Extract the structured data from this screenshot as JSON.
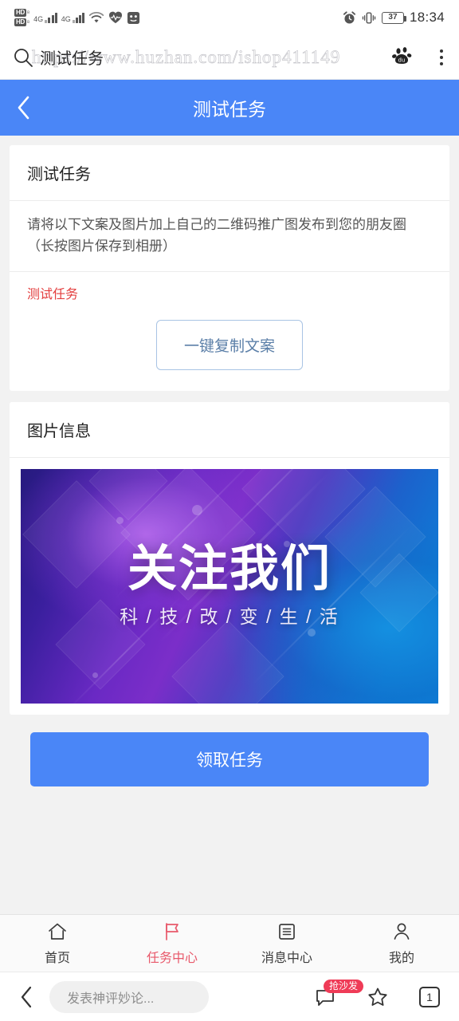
{
  "statusbar": {
    "hd_badge_1": "HD",
    "hd_badge_2": "HD",
    "hd_sub_1": "в",
    "hd_sub_2": "в",
    "net_1": "4G",
    "net_2": "4G",
    "battery": "37",
    "time": "18:34",
    "icons": [
      "hd-badge-icon",
      "signal-4g-icon",
      "wifi-icon",
      "heart-rate-icon",
      "app-icon",
      "alarm-clock-icon",
      "vibrate-icon",
      "battery-icon"
    ]
  },
  "browser": {
    "title": "测试任务",
    "watermark": "https://www.huzhan.com/ishop411149",
    "search_icon": "search-icon",
    "logo_icon": "baidu-logo-icon",
    "menu_icon": "more-vertical-icon"
  },
  "page_header": {
    "title": "测试任务",
    "back_icon": "chevron-left-icon"
  },
  "task_card": {
    "title": "测试任务",
    "description": "请将以下文案及图片加上自己的二维码推广图发布到您的朋友圈（长按图片保存到相册）",
    "copy_text": "测试任务",
    "copy_button": "一键复制文案"
  },
  "image_card": {
    "title": "图片信息",
    "banner": {
      "main_text": "关注我们",
      "sub_text": "科 / 技 / 改 / 变 / 生 / 活",
      "gradient_start": "#261a7e",
      "gradient_mid": "#7b2ec9",
      "gradient_end": "#0d7fd8"
    }
  },
  "claim": {
    "label": "领取任务",
    "color": "#4a86f7"
  },
  "tabbar": {
    "items": [
      {
        "label": "首页",
        "icon": "home-icon",
        "active": false
      },
      {
        "label": "任务中心",
        "icon": "flag-icon",
        "active": true
      },
      {
        "label": "消息中心",
        "icon": "list-icon",
        "active": false
      },
      {
        "label": "我的",
        "icon": "person-icon",
        "active": false
      }
    ],
    "active_color": "#e8596b"
  },
  "browser_bottom": {
    "back_icon": "chevron-left-icon",
    "comment_placeholder": "发表神评妙论...",
    "comment_icon": "comment-icon",
    "comment_badge": "抢沙发",
    "star_icon": "star-icon",
    "tab_count": "1",
    "badge_color": "#ef3b57"
  }
}
